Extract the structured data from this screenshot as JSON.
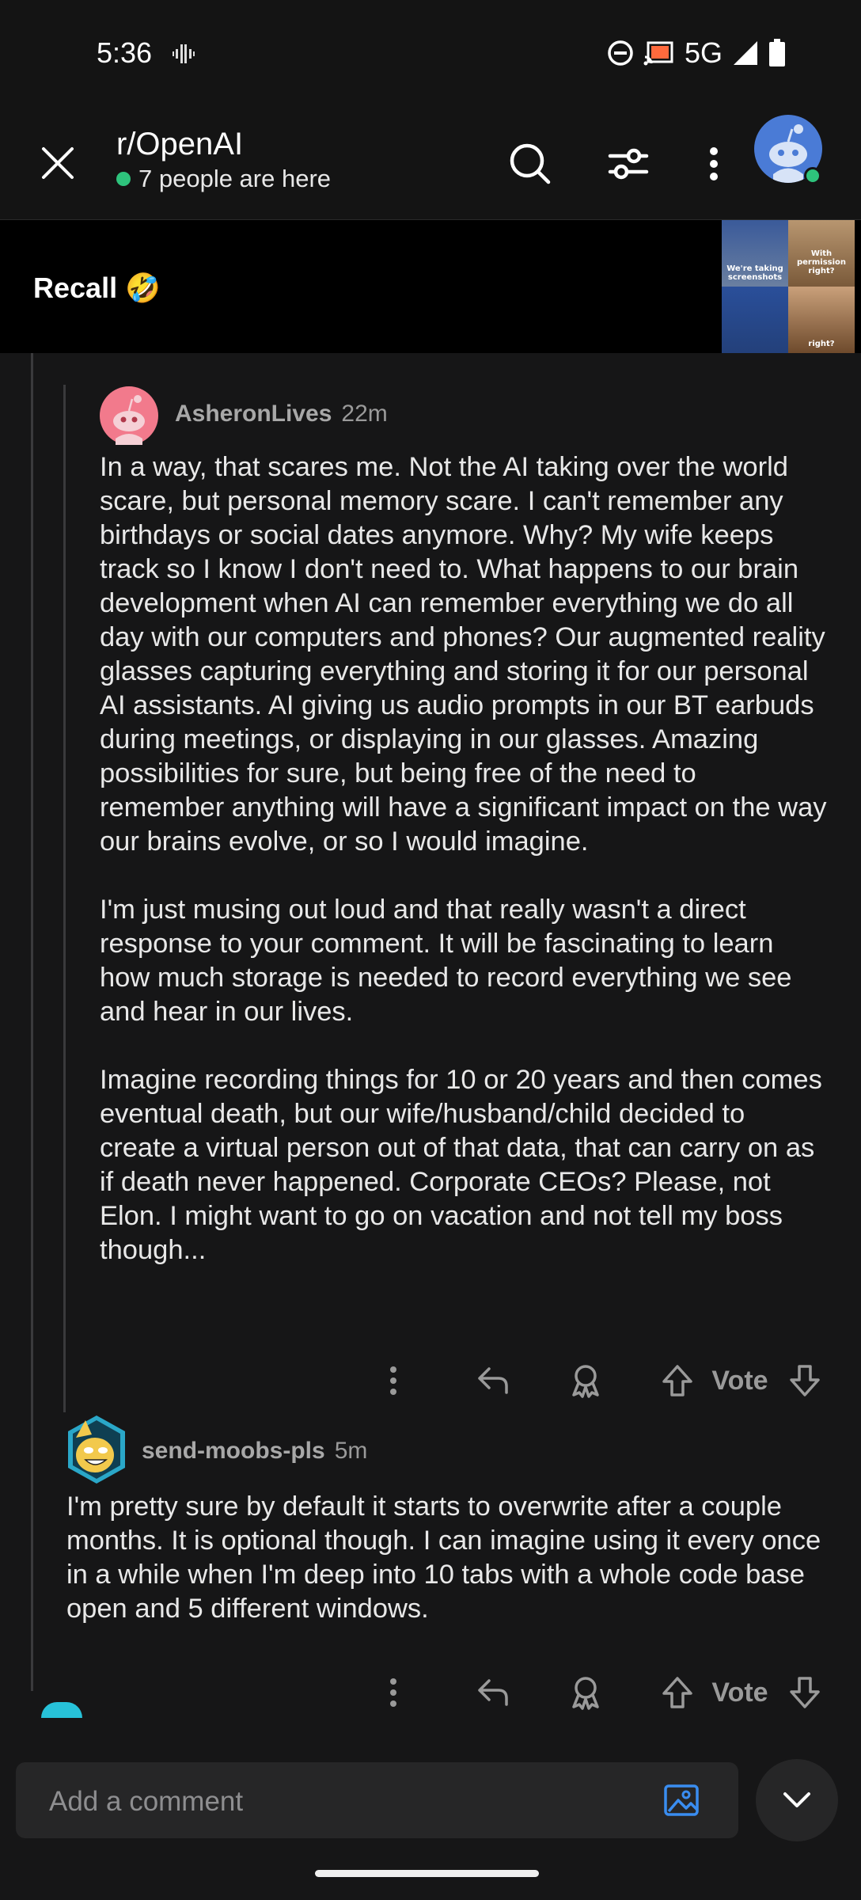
{
  "status_bar": {
    "time": "5:36",
    "network": "5G"
  },
  "header": {
    "subreddit": "r/OpenAI",
    "presence": "7 people are here"
  },
  "post": {
    "title": "Recall 🤣",
    "thumbnail_captions": [
      "We're taking screenshots",
      "With permission right?",
      "",
      "right?"
    ]
  },
  "comments": [
    {
      "author": "AsheronLives",
      "age": "22m",
      "paragraphs": [
        "In a way, that scares me.  Not the AI taking over the world scare, but personal memory scare.  I can't remember any birthdays or social dates anymore.  Why?  My wife keeps track so I know I don't need to.  What happens to our brain development when AI can remember everything we do all day with our computers and phones?  Our augmented reality glasses capturing everything and storing it for our personal AI assistants.  AI giving us audio prompts in our BT earbuds during meetings, or displaying in our glasses.  Amazing possibilities for sure, but being free of the need to remember anything will have a significant impact on the way our brains evolve, or so I would imagine.",
        "I'm just musing out loud and that really wasn't a direct response to your comment.  It will be fascinating to learn how much storage is needed to record everything we see and hear in our lives.",
        "Imagine recording things for 10 or 20 years and then comes eventual death, but our wife/husband/child decided to create a virtual person out of that data, that can carry on as if death never happened.  Corporate CEOs?  Please, not Elon.  I might want to go on vacation and not tell my boss though..."
      ],
      "vote_label": "Vote"
    },
    {
      "author": "send-moobs-pls",
      "age": "5m",
      "paragraphs": [
        "I'm pretty sure by default it starts to overwrite after a couple months. It is optional though. I can imagine using it every once in a while when I'm deep into 10 tabs with a whole code base open and 5 different windows."
      ],
      "vote_label": "Vote"
    }
  ],
  "composer": {
    "placeholder": "Add a comment"
  },
  "colors": {
    "background": "#161617",
    "online": "#2ec37c",
    "accent_blue": "#3a8df0"
  }
}
